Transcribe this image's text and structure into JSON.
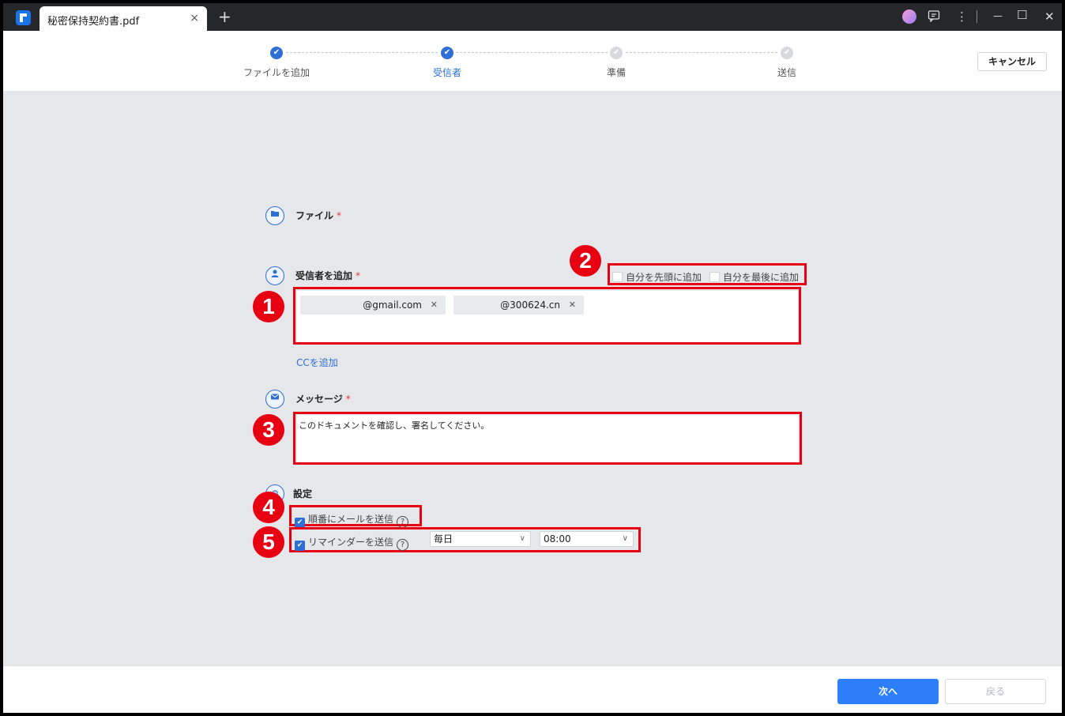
{
  "tab": {
    "title": "秘密保持契約書.pdf",
    "close": "×",
    "new_tab": "+"
  },
  "window_controls": {
    "comment_icon": "comment-icon",
    "more": "⋮",
    "minimize": "—",
    "maximize": "☐",
    "close": "✕"
  },
  "steps": [
    {
      "label": "ファイルを追加",
      "state": "done"
    },
    {
      "label": "受信者",
      "state": "current"
    },
    {
      "label": "準備",
      "state": "todo"
    },
    {
      "label": "送信",
      "state": "todo"
    }
  ],
  "cancel_label": "キャンセル",
  "file_section": {
    "title": "ファイル",
    "required": "*"
  },
  "recipients_section": {
    "title": "受信者を追加",
    "required": "*",
    "add_self_first": "自分を先頭に追加",
    "add_self_last": "自分を最後に追加",
    "chips": [
      "@gmail.com",
      "@300624.cn"
    ],
    "add_cc": "CCを追加"
  },
  "message_section": {
    "title": "メッセージ",
    "required": "*",
    "text": "このドキュメントを確認し、署名してください。"
  },
  "settings_section": {
    "title": "設定",
    "sequential_label": "順番にメールを送信",
    "sequential_checked": true,
    "reminder_label": "リマインダーを送信",
    "reminder_checked": true,
    "frequency": "毎日",
    "time": "08:00"
  },
  "annotations": [
    "1",
    "2",
    "3",
    "4",
    "5"
  ],
  "footer": {
    "next": "次へ",
    "back": "戻る"
  },
  "colors": {
    "accent": "#2d6fd5",
    "highlight": "#e60012"
  }
}
